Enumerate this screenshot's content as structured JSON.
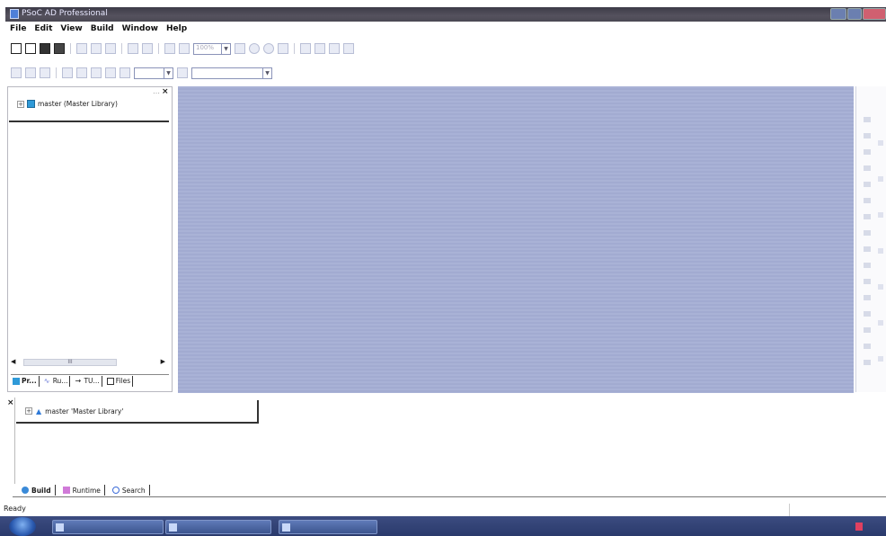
{
  "window": {
    "title": "PSoC AD Professional"
  },
  "menu": {
    "items": [
      "File",
      "Edit",
      "View",
      "Build",
      "Window",
      "Help"
    ]
  },
  "toolbar": {
    "zoom_value": "100%"
  },
  "left_panel": {
    "tree_root": "master (Master Library)",
    "scroll_label": "III",
    "tabs": [
      "Pr...",
      "Ru...",
      "TU...",
      "Files"
    ]
  },
  "bottom_panel": {
    "tree_root": "master 'Master Library'",
    "tabs": [
      "Build",
      "Runtime",
      "Search"
    ]
  },
  "status": {
    "text": "Ready"
  },
  "colors": {
    "workspace": "#a9b2d6",
    "titlebar": "#4a4853",
    "taskbar": "#2a3a6c"
  }
}
